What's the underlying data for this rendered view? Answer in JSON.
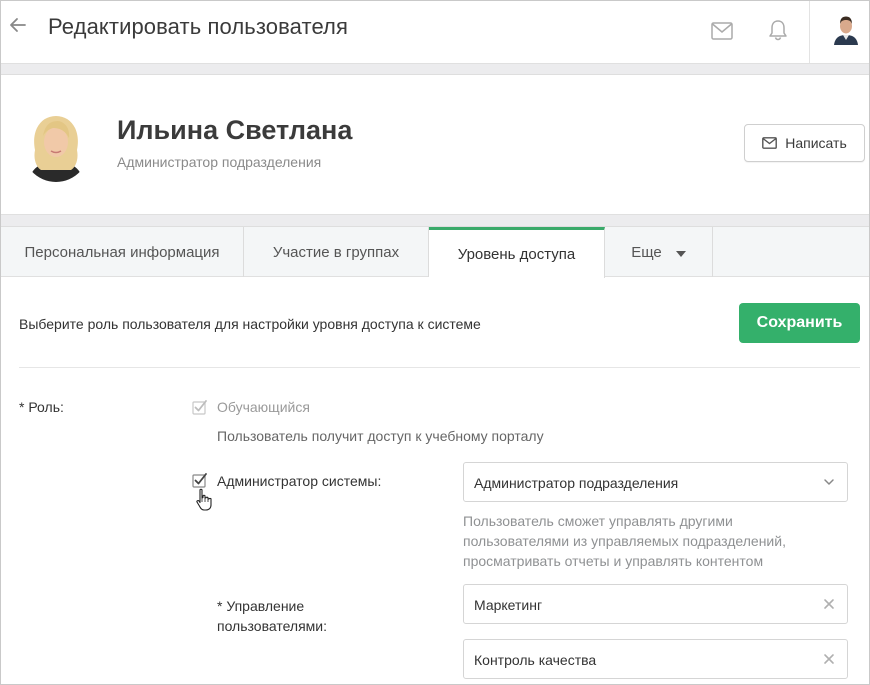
{
  "header": {
    "title": "Редактировать пользователя",
    "icons": [
      "back-arrow-icon",
      "mail-icon",
      "bell-icon",
      "user-avatar"
    ]
  },
  "profile": {
    "name": "Ильина Светлана",
    "role": "Администратор подразделения",
    "write_button": "Написать"
  },
  "tabs": [
    {
      "label": "Персональная информация",
      "active": false
    },
    {
      "label": "Участие в группах",
      "active": false
    },
    {
      "label": "Уровень доступа",
      "active": true
    },
    {
      "label": "Еще",
      "active": false
    }
  ],
  "content": {
    "intro": "Выберите роль пользователя для настройки уровня доступа к системе",
    "save_button": "Сохранить",
    "role_label": "* Роль:",
    "learner": {
      "label": "Обучающийся",
      "description": "Пользователь получит доступ к учебному порталу",
      "checked": true,
      "disabled": true
    },
    "admin": {
      "label": "Администратор системы:",
      "checked": true,
      "select_value": "Администратор подразделения",
      "description_lines": [
        "Пользователь сможет управлять другими",
        "пользователями из управляемых подразделений,",
        "просматривать отчеты и управлять контентом"
      ]
    },
    "user_management": {
      "label_lines": [
        "* Управление",
        "пользователями:"
      ],
      "values": [
        "Маркетинг",
        "Контроль качества"
      ]
    }
  },
  "colors": {
    "accent": "#34b06b",
    "tab_active_border": "#3aaa6a",
    "band": "#ececee"
  }
}
